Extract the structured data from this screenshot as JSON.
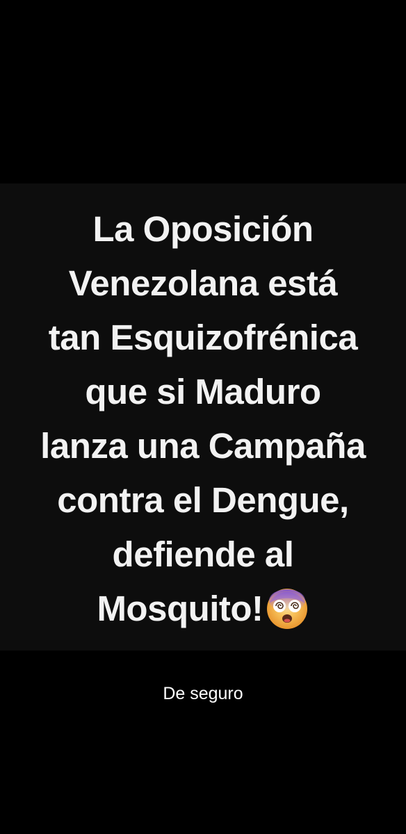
{
  "meme": {
    "lines": [
      "La Oposición",
      "Venezolana está",
      "tan Esquizofrénica",
      "que si Maduro",
      "lanza una Campaña",
      "contra el Dengue,",
      "defiende al",
      "Mosquito!"
    ],
    "emoji": "dizzy-face-icon"
  },
  "caption": "De seguro"
}
